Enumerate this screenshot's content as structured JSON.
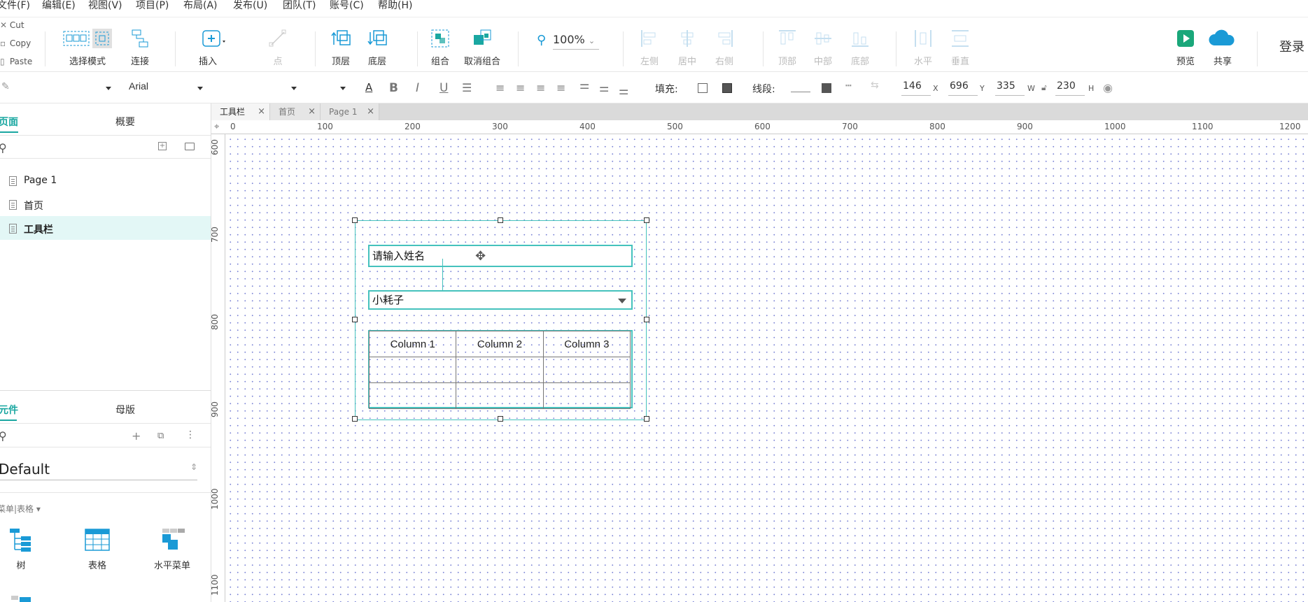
{
  "menu": [
    "文件(F)",
    "编辑(E)",
    "视图(V)",
    "项目(P)",
    "布局(A)",
    "发布(U)",
    "团队(T)",
    "账号(C)",
    "帮助(H)"
  ],
  "clipboard": {
    "cut": "Cut",
    "copy": "Copy",
    "paste": "Paste"
  },
  "toolbar": {
    "select_mode": "选择模式",
    "connect": "连接",
    "insert": "插入",
    "point": "点",
    "top_layer": "顶层",
    "bottom_layer": "底层",
    "group": "组合",
    "ungroup": "取消组合",
    "zoom": "100%",
    "align_left": "左侧",
    "align_center": "居中",
    "align_right": "右侧",
    "align_top": "顶部",
    "align_middle": "中部",
    "align_bottom": "底部",
    "dist_h": "水平",
    "dist_v": "垂直",
    "preview": "预览",
    "share": "共享",
    "login": "登录"
  },
  "format": {
    "font": "Arial",
    "fill_label": "填充:",
    "stroke_label": "线段:",
    "x": "146",
    "x_unit": "X",
    "y": "696",
    "y_unit": "Y",
    "w": "335",
    "w_unit": "W",
    "h": "230",
    "h_unit": "H"
  },
  "pages_panel": {
    "tab_pages": "页面",
    "tab_outline": "概要",
    "items": [
      "Page 1",
      "首页",
      "工具栏"
    ],
    "selected_index": 2
  },
  "widgets_panel": {
    "tab_widgets": "元件",
    "tab_masters": "母版",
    "library": "Default",
    "category": "菜单|表格 ▾",
    "items": [
      "树",
      "表格",
      "水平菜单"
    ]
  },
  "doc_tabs": [
    "工具栏",
    "首页",
    "Page 1"
  ],
  "ruler_h": [
    "0",
    "100",
    "200",
    "300",
    "400",
    "500",
    "600",
    "700",
    "800",
    "900",
    "1000",
    "1100",
    "1200"
  ],
  "ruler_v": [
    "600",
    "700",
    "800",
    "900",
    "1000",
    "1100"
  ],
  "canvas": {
    "input_text": "请输入姓名",
    "select_text": "小耗子",
    "table": {
      "headers": [
        "Column 1",
        "Column 2",
        "Column 3"
      ],
      "rows": [
        [
          "",
          "",
          ""
        ],
        [
          "",
          "",
          ""
        ]
      ]
    }
  },
  "colors": {
    "accent": "#45c2bd",
    "selected_row": "#e3f7f6",
    "tab_active": "#1aa7a1",
    "toolbar_icon": "#1a9ad6"
  }
}
